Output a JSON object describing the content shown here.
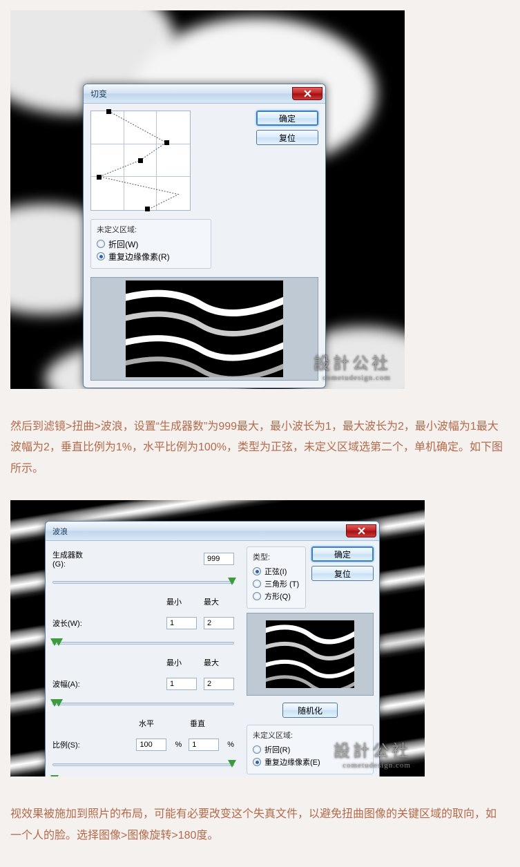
{
  "shear": {
    "title": "切变",
    "ok": "确定",
    "reset": "复位",
    "undef_legend": "未定义区域:",
    "wrap": "折回(W)",
    "repeat": "重复边缘像素(R)"
  },
  "para1": "然后到滤镜>扭曲>波浪，设置“生成器数”为999最大，最小波长为1，最大波长为2，最小波幅为1最大波幅为2，垂直比例为1%，水平比例为100%，类型为正弦，未定义区域选第二个，单机确定。如下图所示。",
  "wave": {
    "title": "波浪",
    "ok": "确定",
    "reset": "复位",
    "gen_label": "生成器数(G):",
    "gen_val": "999",
    "min_h": "最小",
    "max_h": "最大",
    "wlen_label": "波长(W):",
    "wlen_min": "1",
    "wlen_max": "2",
    "amp_label": "波幅(A):",
    "amp_min": "1",
    "amp_max": "2",
    "scale_label": "比例(S):",
    "h_lbl": "水平",
    "v_lbl": "垂直",
    "h_val": "100",
    "v_val": "1",
    "type_legend": "类型:",
    "sine": "正弦(I)",
    "tri": "三角形 (T)",
    "square": "方形(Q)",
    "random": "随机化",
    "undef_legend": "未定义区域:",
    "wrap": "折回(R)",
    "repeat": "重复边缘像素(E)"
  },
  "watermark": {
    "main": "設計公社",
    "sub": "cometudesign.com"
  },
  "para2": "视效果被施加到照片的布局，可能有必要改变这个失真文件，以避免扭曲图像的关键区域的取向，如一个人的脸。选择图像>图像旋转>180度。"
}
